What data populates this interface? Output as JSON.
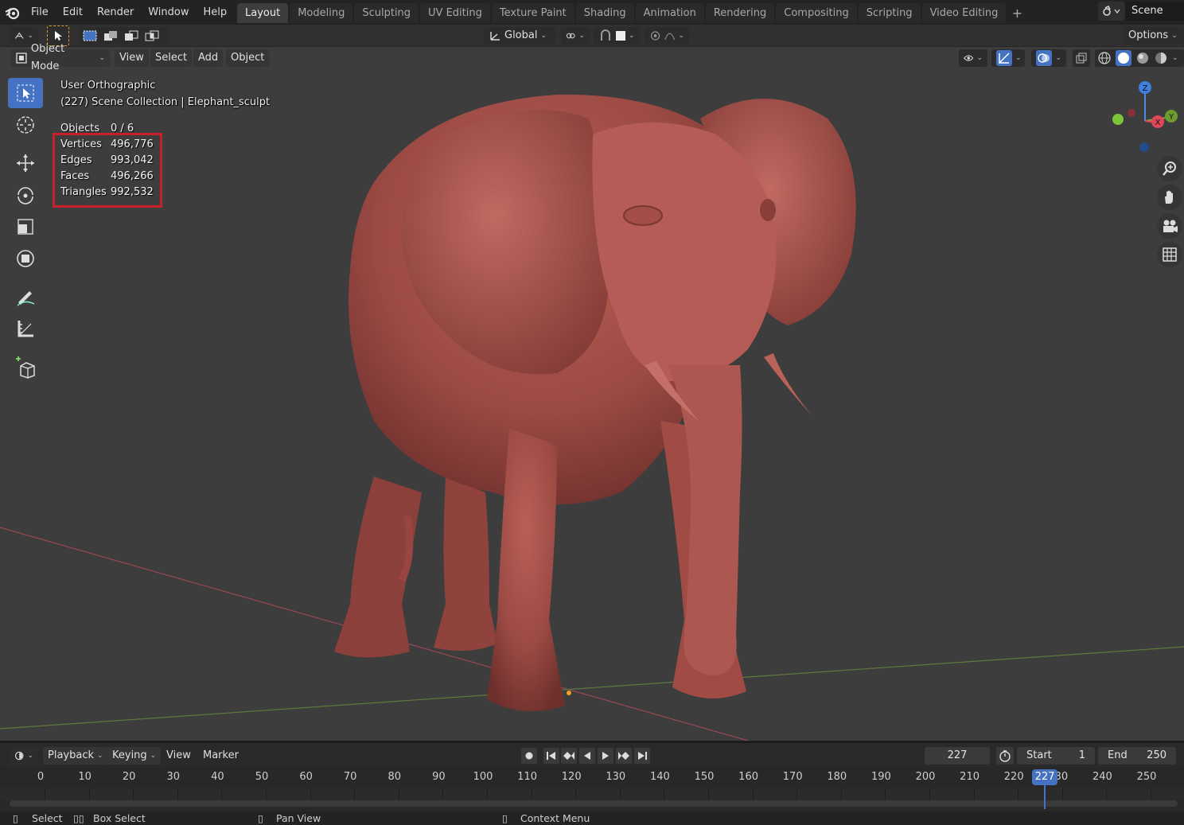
{
  "topbar": {
    "menus": [
      "File",
      "Edit",
      "Render",
      "Window",
      "Help"
    ],
    "workspace_tabs": [
      "Layout",
      "Modeling",
      "Sculpting",
      "UV Editing",
      "Texture Paint",
      "Shading",
      "Animation",
      "Rendering",
      "Compositing",
      "Scripting",
      "Video Editing"
    ],
    "active_tab": "Layout",
    "add_tab": "+",
    "scene_label": "Scene"
  },
  "tool_header": {
    "transform_orientation": "Global",
    "options_label": "Options"
  },
  "viewport_header": {
    "mode": "Object Mode",
    "menus": [
      "View",
      "Select",
      "Add",
      "Object"
    ]
  },
  "viewport": {
    "view_name": "User Orthographic",
    "collection_info": "(227) Scene Collection | Elephant_sculpt",
    "stats": {
      "objects_label": "Objects",
      "objects_value": "0 / 6",
      "vertices_label": "Vertices",
      "vertices_value": "496,776",
      "edges_label": "Edges",
      "edges_value": "993,042",
      "faces_label": "Faces",
      "faces_value": "496,266",
      "triangles_label": "Triangles",
      "triangles_value": "992,532"
    },
    "gizmo": {
      "z": "Z",
      "y": "Y",
      "x": "X"
    }
  },
  "timeline": {
    "menus": [
      "Playback",
      "Keying",
      "View",
      "Marker"
    ],
    "current_frame": "227",
    "start_label": "Start",
    "start_value": "1",
    "end_label": "End",
    "end_value": "250",
    "ruler_ticks": [
      "0",
      "10",
      "20",
      "30",
      "40",
      "50",
      "60",
      "70",
      "80",
      "90",
      "100",
      "110",
      "120",
      "130",
      "140",
      "150",
      "160",
      "170",
      "180",
      "190",
      "200",
      "210",
      "220",
      "230",
      "240",
      "250"
    ],
    "playhead_label": "227"
  },
  "statusbar": {
    "select": "Select",
    "box_select": "Box Select",
    "pan_view": "Pan View",
    "context_menu": "Context Menu"
  },
  "colors": {
    "accent": "#4672c4",
    "highlight_box": "#c8202a",
    "model": "#a4504a",
    "axis_x": "#c0505a",
    "axis_y": "#6a8a3a"
  }
}
